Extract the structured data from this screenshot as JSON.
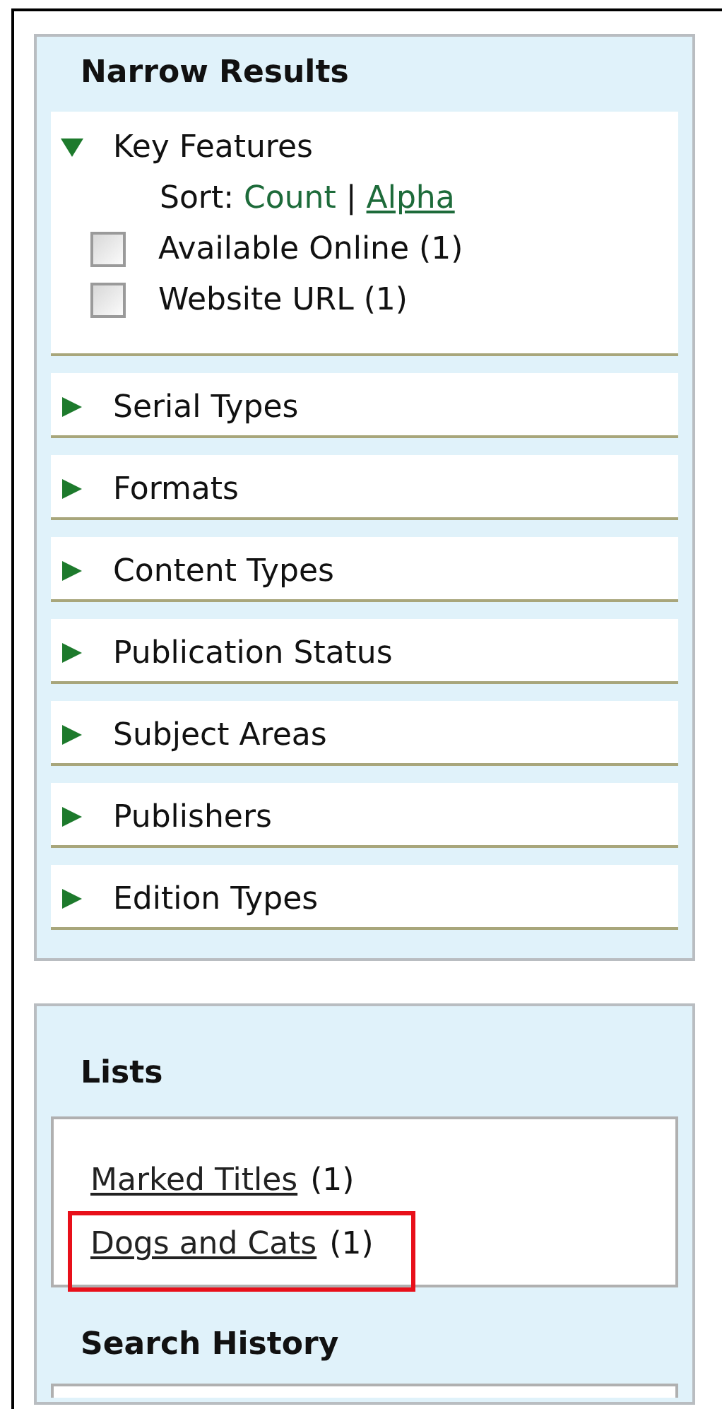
{
  "narrow_results": {
    "title": "Narrow Results",
    "facets": [
      {
        "label": "Key Features",
        "expanded": true,
        "sort": {
          "label": "Sort:",
          "separator": "|",
          "options": [
            {
              "label": "Count",
              "selected": true
            },
            {
              "label": "Alpha",
              "selected": false
            }
          ]
        },
        "options": [
          {
            "label": "Available Online (1)",
            "checked": false
          },
          {
            "label": "Website URL (1)",
            "checked": false
          }
        ]
      },
      {
        "label": "Serial Types",
        "expanded": false
      },
      {
        "label": "Formats",
        "expanded": false
      },
      {
        "label": "Content Types",
        "expanded": false
      },
      {
        "label": "Publication Status",
        "expanded": false
      },
      {
        "label": "Subject Areas",
        "expanded": false
      },
      {
        "label": "Publishers",
        "expanded": false
      },
      {
        "label": "Edition Types",
        "expanded": false
      }
    ]
  },
  "lists": {
    "title": "Lists",
    "items": [
      {
        "label": "Marked Titles",
        "count": "(1)",
        "highlighted": false
      },
      {
        "label": "Dogs and Cats",
        "count": "(1)",
        "highlighted": true
      }
    ]
  },
  "search_history": {
    "title": "Search History"
  }
}
